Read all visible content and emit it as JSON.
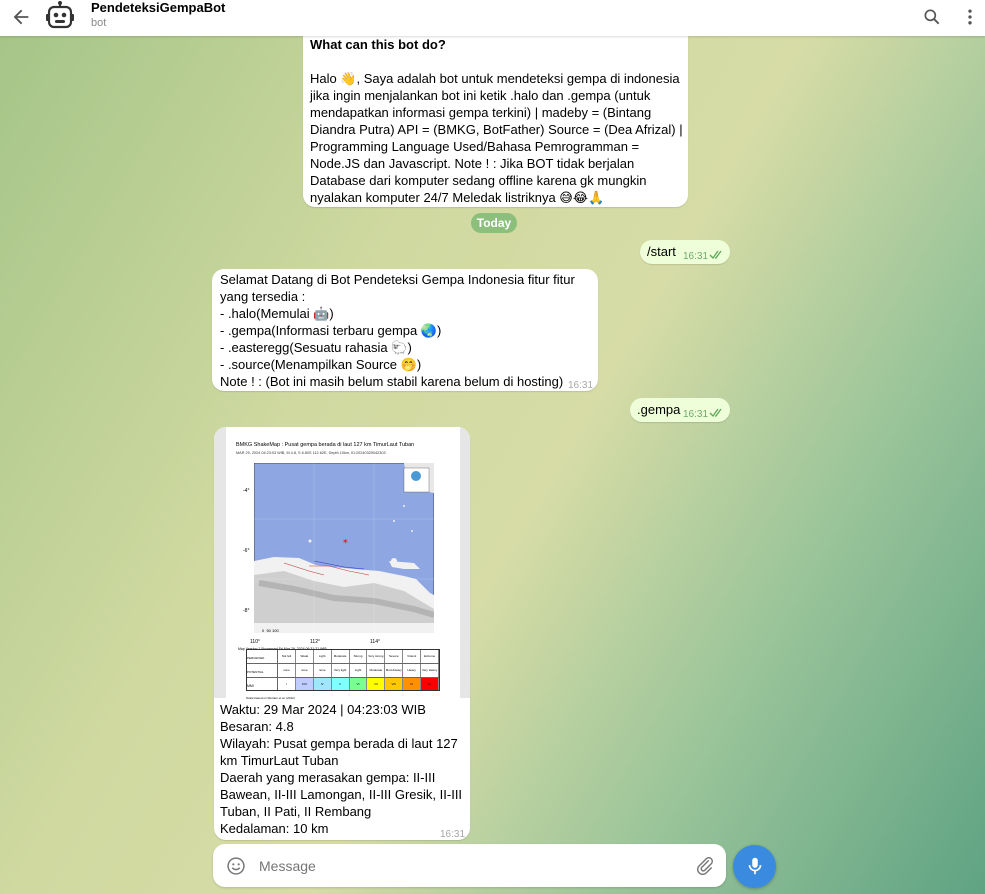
{
  "header": {
    "title": "PendeteksiGempaBot",
    "subtitle": "bot",
    "back_icon": "arrow-left-icon",
    "search_icon": "search-icon",
    "menu_icon": "more-vertical-icon"
  },
  "intro": {
    "heading": "What can this bot do?",
    "lines": [
      "Halo 👋, Saya adalah bot untuk mendeteksi gempa di indonesia",
      "jika ingin menjalankan bot ini ketik .halo dan .gempa (untuk",
      "mendapatkan informasi gempa terkini) | madeby = (Bintang",
      "Diandra Putra) API = (BMKG, BotFather) Source = (Dea Afrizal) |",
      "Programming Language Used/Bahasa Pemrogramman =",
      "Node.JS dan Javascript. Note ! : Jika BOT tidak berjalan",
      "Database dari komputer sedang offline karena gk mungkin",
      "nyalakan komputer 24/7 Meledak listriknya 😅😂🙏"
    ]
  },
  "date_separator": "Today",
  "msg_start": {
    "text": "/start",
    "time": "16:31"
  },
  "welcome": {
    "lines": [
      "Selamat Datang di Bot Pendeteksi Gempa Indonesia fitur fitur",
      "yang tersedia :",
      "- .halo(Memulai 🤖)",
      "- .gempa(Informasi terbaru gempa 🌏)",
      "- .easteregg(Sesuatu rahasia 🐑)",
      "- .source(Menampilkan Source 🤭)",
      "Note ! : (Bot ini masih belum stabil karena belum di hosting)"
    ],
    "time": "16:31"
  },
  "msg_gempa": {
    "text": ".gempa",
    "time": "16:31"
  },
  "quake": {
    "map_title": "BMKG ShakeMap : Pusat gempa berada di laut 127 km TimurLaut Tuban",
    "map_subtitle": "MAR 29, 2024 04:23:03 WIB, M 4.8, S 6.80S 112.62E, Depth 10km, ID:20240329042303",
    "map_lats": [
      "-4°",
      "-6°",
      "-8°"
    ],
    "map_lons": [
      "110°",
      "112°",
      "114°"
    ],
    "map_scale": "0  50 100",
    "map_footer": "Map Version 1 Processed Fri Mar 29, 2024 06:31:21 WIB",
    "table_rows": {
      "perceived_label": "PERCEIVED SHAKING",
      "damage_label": "POTENTIAL DAMAGE",
      "intensity_label": "MMI",
      "shaking": [
        "Not felt",
        "Weak",
        "Light",
        "Moderate",
        "Strong",
        "Very strong",
        "Severe",
        "Violent",
        "Extreme"
      ],
      "damage": [
        "none",
        "none",
        "none",
        "Very light",
        "Light",
        "Moderate",
        "Mod./Heavy",
        "Heavy",
        "Very Heavy"
      ],
      "intensity": [
        "I",
        "II-III",
        "IV",
        "V",
        "VI",
        "VII",
        "VIII",
        "IX",
        "X+"
      ],
      "colors": [
        "#ffffff",
        "#bfccff",
        "#a0e6ff",
        "#80ffff",
        "#7aff93",
        "#ffff00",
        "#ffc800",
        "#ff9100",
        "#ff0000"
      ]
    },
    "table_footer": "Scale based on Worden et al. (2012)",
    "lines": [
      "Waktu: 29 Mar 2024 | 04:23:03 WIB",
      "Besaran: 4.8",
      "Wilayah: Pusat gempa berada di laut 127",
      "km TimurLaut Tuban",
      "Daerah yang merasakan gempa: II-III",
      "Bawean, II-III Lamongan, II-III Gresik, II-III",
      "Tuban, II Pati, II Rembang",
      "Kedalaman: 10 km"
    ],
    "time": "16:31"
  },
  "composer": {
    "placeholder": "Message",
    "emoji_icon": "smile-icon",
    "attach_icon": "paperclip-icon",
    "mic_icon": "microphone-icon"
  },
  "colors": {
    "accent": "#3a8be0",
    "outgoing": "#eefed9",
    "date_pill": "#8cbf7c"
  }
}
